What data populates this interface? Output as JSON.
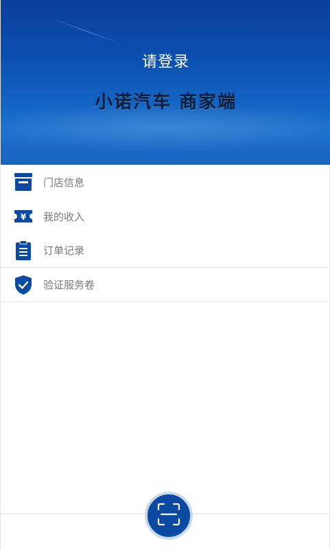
{
  "header": {
    "login_prompt": "请登录",
    "brand": "小诺汽车 商家端"
  },
  "menu": {
    "items": [
      {
        "label": "门店信息",
        "icon": "store-icon"
      },
      {
        "label": "我的收入",
        "icon": "yuan-ticket-icon"
      },
      {
        "label": "订单记录",
        "icon": "clipboard-icon"
      },
      {
        "label": "验证服务卷",
        "icon": "shield-check-icon"
      }
    ]
  },
  "bottom_bar": {
    "scan_icon": "scan-icon"
  },
  "colors": {
    "accent": "#0a4aa3",
    "header_top": "#0a3f9a",
    "header_bottom": "#1a6bc6",
    "label_text": "#7a7a7a"
  }
}
